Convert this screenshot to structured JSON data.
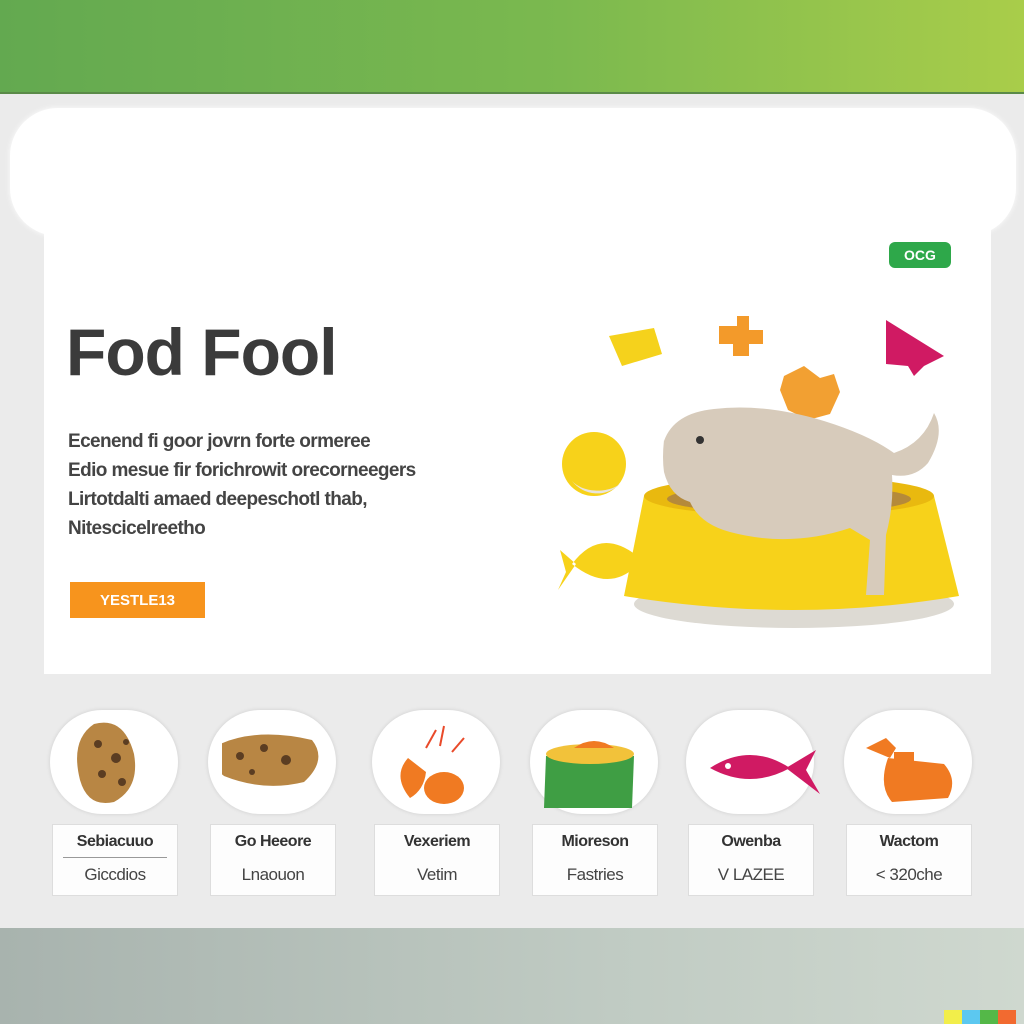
{
  "hero": {
    "badge": "OCG",
    "title": "Fod Fool",
    "description": [
      "Ecenend fi goor jovrn forte ormeree",
      "Edio mesue fir forichrowit orecorneegers",
      "Lirtotdalti amaed deepeschotl thab,",
      "Nitescicelreetho"
    ],
    "cta_label": "YESTLE13"
  },
  "products": [
    {
      "name": "Sebiacuuo",
      "price": "Giccdios"
    },
    {
      "name": "Go Heeore",
      "price": "Lnaouon"
    },
    {
      "name": "Vexeriem",
      "price": "Vetim"
    },
    {
      "name": "Mioreson",
      "price": "Fastries"
    },
    {
      "name": "Owenba",
      "price": "V LAZEE"
    },
    {
      "name": "Wactom",
      "price": "< 320che"
    }
  ],
  "colors": {
    "header_green": "#6db24f",
    "accent_orange": "#f7941d",
    "badge_green": "#2ea84a",
    "bowl_yellow": "#f7d21a"
  },
  "icons": [
    "cookie-icon",
    "bread-icon",
    "carrot-icon",
    "bowl-icon",
    "fish-icon",
    "bone-icon"
  ]
}
